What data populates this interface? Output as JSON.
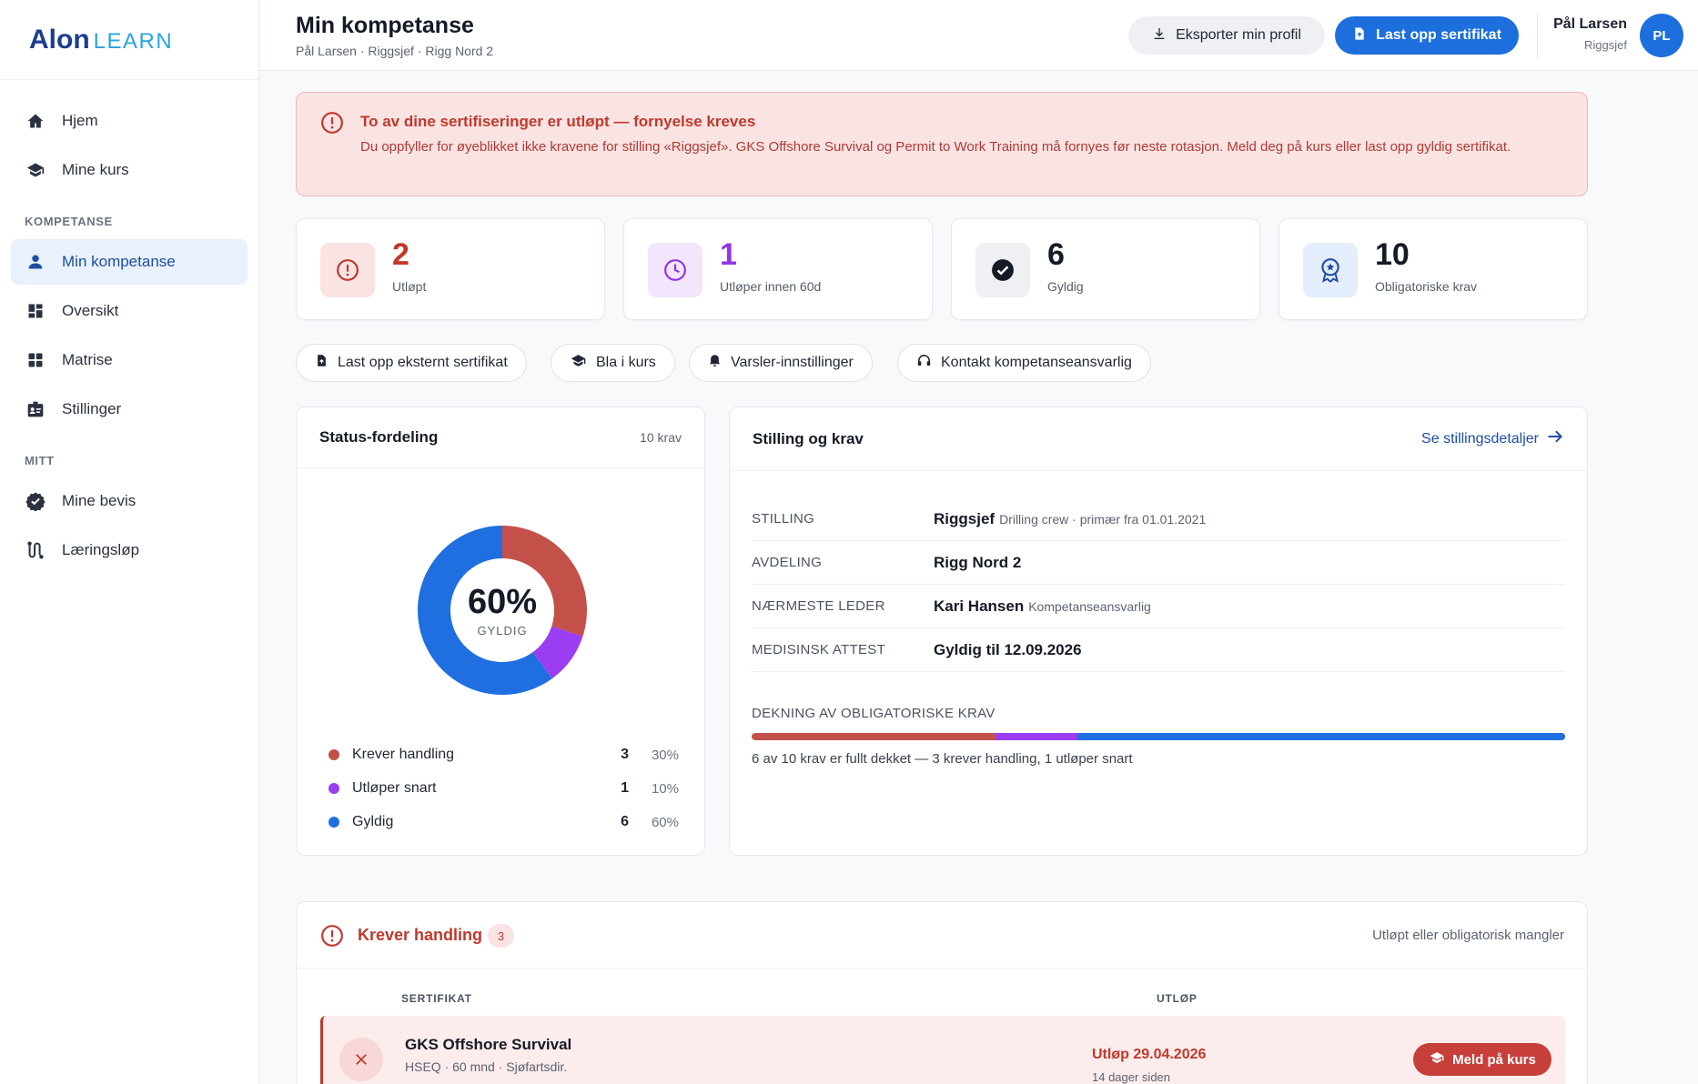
{
  "app": {
    "logo_main": "Alon",
    "logo_sub": "LEARN"
  },
  "sidebar": {
    "items": [
      {
        "label": "Hjem",
        "icon": "home-icon"
      },
      {
        "label": "Mine kurs",
        "icon": "graduation-cap-icon"
      }
    ],
    "section_kompetanse": "KOMPETANSE",
    "kompetanse_items": [
      {
        "label": "Min kompetanse",
        "icon": "user-icon",
        "active": true
      },
      {
        "label": "Oversikt",
        "icon": "dashboard-icon"
      },
      {
        "label": "Matrise",
        "icon": "grid-icon"
      },
      {
        "label": "Stillinger",
        "icon": "id-badge-icon"
      }
    ],
    "section_mitt": "MITT",
    "mitt_items": [
      {
        "label": "Mine bevis",
        "icon": "verified-badge-icon"
      },
      {
        "label": "Læringsløp",
        "icon": "route-icon"
      }
    ]
  },
  "header": {
    "title": "Min kompetanse",
    "subtitle": "Pål Larsen · Riggsjef · Rigg Nord 2",
    "export_label": "Eksporter min profil",
    "upload_label": "Last opp sertifikat",
    "user_name": "Pål Larsen",
    "user_role": "Riggsjef",
    "avatar_initials": "PL"
  },
  "alert": {
    "title": "To av dine sertifiseringer er utløpt — fornyelse kreves",
    "text": "Du oppfyller for øyeblikket ikke kravene for stilling «Riggsjef». GKS Offshore Survival og Permit to Work Training må fornyes før neste rotasjon. Meld deg på kurs eller last opp gyldig sertifikat."
  },
  "stats": [
    {
      "value": "2",
      "label": "Utløpt",
      "color": "#c0392b",
      "bg": "#fae3e3"
    },
    {
      "value": "1",
      "label": "Utløper innen 60d",
      "color": "#9333ea",
      "bg": "#f1e6fb"
    },
    {
      "value": "6",
      "label": "Gyldig",
      "color": "#141a26",
      "bg": "#eef0f3"
    },
    {
      "value": "10",
      "label": "Obligatoriske krav",
      "color": "#141a26",
      "bg": "#e3edfb"
    }
  ],
  "quick_actions": [
    {
      "label": "Last opp eksternt sertifikat"
    },
    {
      "label": "Bla i kurs"
    },
    {
      "label": "Varsler-innstillinger"
    },
    {
      "label": "Kontakt kompetanseansvarlig"
    }
  ],
  "status_panel": {
    "title": "Status-fordeling",
    "meta": "10 krav",
    "center_value": "60%",
    "center_label": "GYLDIG",
    "legend": [
      {
        "label": "Krever handling",
        "count": "3",
        "pct": "30%",
        "color": "#c4504a"
      },
      {
        "label": "Utløper snart",
        "count": "1",
        "pct": "10%",
        "color": "#9b3df0"
      },
      {
        "label": "Gyldig",
        "count": "6",
        "pct": "60%",
        "color": "#1f6fe0"
      }
    ]
  },
  "chart_data": {
    "type": "pie",
    "categories": [
      "Krever handling",
      "Utløper snart",
      "Gyldig"
    ],
    "values": [
      3,
      1,
      6
    ],
    "colors": [
      "#c4504a",
      "#9b3df0",
      "#1f6fe0"
    ],
    "title": "Status-fordeling"
  },
  "stilling_panel": {
    "title": "Stilling og krav",
    "link": "Se stillingsdetaljer",
    "rows": [
      {
        "key": "STILLING",
        "value": "Riggsjef",
        "extra": "Drilling crew · primær fra 01.01.2021"
      },
      {
        "key": "AVDELING",
        "value": "Rigg Nord 2",
        "extra": ""
      },
      {
        "key": "NÆRMESTE LEDER",
        "value": "Kari Hansen",
        "extra": "Kompetanseansvarlig"
      },
      {
        "key": "MEDISINSK ATTEST",
        "value": "Gyldig til 12.09.2026",
        "extra": ""
      }
    ],
    "coverage_title": "DEKNING AV OBLIGATORISKE KRAV",
    "coverage_segments": [
      {
        "value": 3,
        "color": "#c4504a"
      },
      {
        "value": 1,
        "color": "#9b3df0"
      },
      {
        "value": 6,
        "color": "#1f6fe0"
      }
    ],
    "coverage_text": "6 av 10 krav er fullt dekket — 3 krever handling, 1 utløper snart"
  },
  "action_panel": {
    "title": "Krever handling",
    "badge": "3",
    "meta": "Utløpt eller obligatorisk mangler",
    "col_cert": "SERTIFIKAT",
    "col_expiry": "UTLØP",
    "rows": [
      {
        "name": "GKS Offshore Survival",
        "sub": "HSEQ · 60 mnd · Sjøfartsdir.",
        "expiry": "Utløp 29.04.2026",
        "ago": "14 dager siden",
        "action": "Meld på kurs"
      }
    ]
  }
}
